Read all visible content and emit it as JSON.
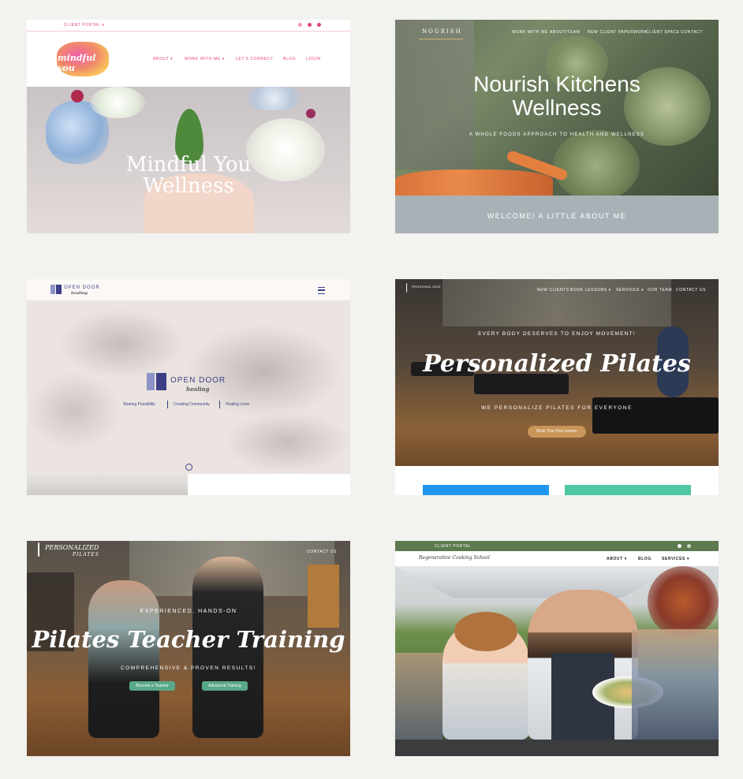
{
  "card1": {
    "client_portal": "CLIENT PORTAL ▾",
    "logo_text": "mindful you",
    "nav": [
      "ABOUT ▾",
      "WORK WITH ME ▾",
      "LET'S CONNECT",
      "BLOG",
      "LOGIN"
    ],
    "hero_line1": "Mindful You",
    "hero_line2": "Wellness"
  },
  "card2": {
    "logo": "NOURISH",
    "nav": [
      "WORK WITH ME",
      "ABOUT/TEAM",
      "NEW CLIENT PAPERWORK",
      "CLIENT SPACE",
      "CONTACT"
    ],
    "title_line1": "Nourish Kitchens",
    "title_line2": "Wellness",
    "tagline": "A WHOLE FOODS APPROACH TO HEALTH AND WELLNESS",
    "welcome": "WELCOME! A LITTLE ABOUT ME"
  },
  "card3": {
    "logo": "OPEN DOOR",
    "logo_sub": "healing",
    "center_logo": "OPEN DOOR",
    "center_sub": "healing",
    "taglines": [
      "Sharing Possibility",
      "Creating Community",
      "Healing Lives"
    ]
  },
  "card4": {
    "logo": "PERSONALIZED",
    "nav": [
      "NEW CLIENTS",
      "BOOK LESSONS ▾",
      "SERVICES ▾",
      "OUR TEAM",
      "CONTACT US"
    ],
    "kicker": "EVERY BODY DESERVES TO ENJOY MOVEMENT!",
    "title": "Personalized Pilates",
    "subtitle": "WE PERSONALIZE PILATES FOR EVERYONE",
    "cta": "Book Your First Lesson"
  },
  "card5": {
    "logo": "PERSONALIZED",
    "logo_sub": "PILATES",
    "contact": "CONTACT US",
    "kicker": "EXPERIENCED, HANDS-ON",
    "title": "Pilates Teacher Training",
    "subtitle": "COMPREHENSIVE & PROVEN RESULTS!",
    "btn1": "Become a Teacher",
    "btn2": "Advanced Training"
  },
  "card6": {
    "client_portal": "CLIENT PORTAL",
    "logo": "Regenerative Cooking School",
    "nav": [
      "ABOUT ▾",
      "BLOG",
      "SERVICES ▾"
    ]
  },
  "colors": {
    "page_bg": "#f2f2ee",
    "pink": "#e0427f",
    "sage_nav": "#5d7a4f",
    "teal_btn": "#5aa88a",
    "tan_btn": "#c9955a",
    "blue_tile": "#1e96f0",
    "green_tile": "#4fc7a5"
  }
}
